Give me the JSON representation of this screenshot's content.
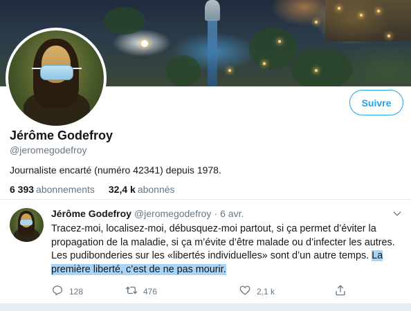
{
  "profile": {
    "name": "Jérôme Godefroy",
    "handle": "@jeromegodefroy",
    "bio": "Journaliste encarté (numéro 42341) depuis 1978.",
    "following_count": "6 393",
    "following_label": "abonnements",
    "followers_count": "32,4 k",
    "followers_label": "abonnés",
    "follow_button": "Suivre"
  },
  "tweet": {
    "author": "Jérôme Godefroy",
    "handle": "@jeromegodefroy",
    "separator": "·",
    "date": "6 avr.",
    "text_plain": "Tracez-moi, localisez-moi, débusquez-moi partout, si ça permet d’éviter la propagation de la maladie, si ça m’évite d’être malade ou d’infecter les autres. Les pudibonderies sur les «libertés individuelles» sont d’un autre temps.",
    "text_highlighted": "La première liberté, c’est de ne pas mourir.",
    "reply_count": "128",
    "retweet_count": "476",
    "like_count": "2,1 k"
  },
  "icons": {
    "reply": "reply-icon",
    "retweet": "retweet-icon",
    "like": "heart-icon",
    "share": "share-icon",
    "menu": "chevron-down-icon"
  },
  "colors": {
    "accent": "#1da1f2",
    "secondary_text": "#657786",
    "highlight": "#a9d4f5"
  }
}
